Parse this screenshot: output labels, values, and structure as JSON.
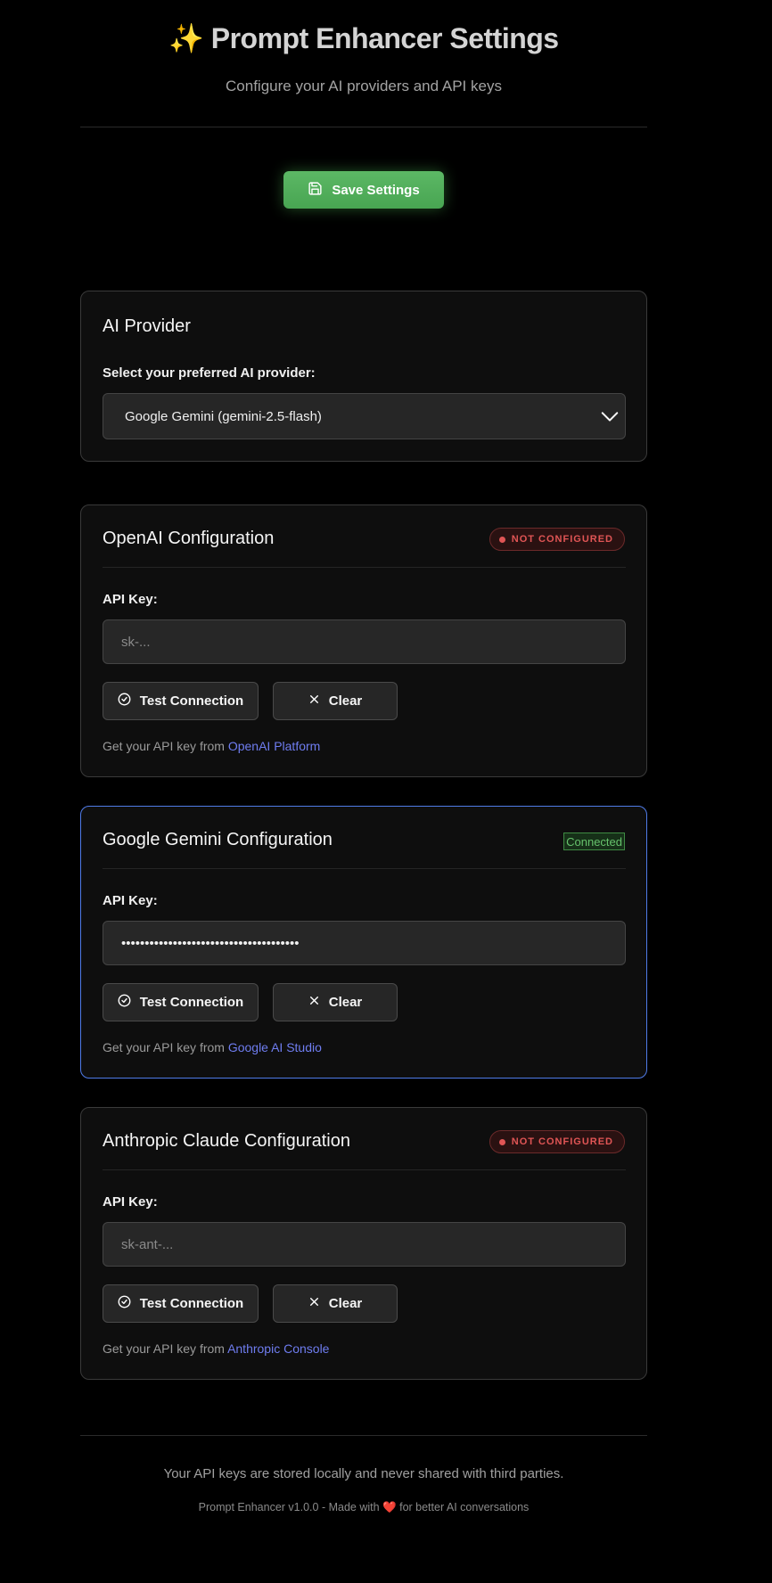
{
  "header": {
    "title_icon": "✨",
    "title": "Prompt Enhancer Settings",
    "subtitle": "Configure your AI providers and API keys"
  },
  "toolbar": {
    "save_label": "Save Settings",
    "save_icon": "save-icon"
  },
  "provider": {
    "heading": "AI Provider",
    "label": "Select your preferred AI provider:",
    "selected": "Google Gemini (gemini-2.5-flash)"
  },
  "openai": {
    "heading": "OpenAI Configuration",
    "status": "NOT CONFIGURED",
    "api_key_label": "API Key:",
    "api_key_value": "",
    "api_key_placeholder": "sk-...",
    "test_label": "Test Connection",
    "clear_label": "Clear",
    "help_prefix": "Get your API key from",
    "help_link": "OpenAI Platform"
  },
  "gemini": {
    "heading": "Google Gemini Configuration",
    "status": "Connected",
    "api_key_label": "API Key:",
    "api_key_value": "••••••••••••••••••••••••••••••••••••••",
    "api_key_placeholder": "",
    "test_label": "Test Connection",
    "clear_label": "Clear",
    "help_prefix": "Get your API key from",
    "help_link": "Google AI Studio"
  },
  "anthropic": {
    "heading": "Anthropic Claude Configuration",
    "status": "NOT CONFIGURED",
    "api_key_label": "API Key:",
    "api_key_value": "",
    "api_key_placeholder": "sk-ant-...",
    "test_label": "Test Connection",
    "clear_label": "Clear",
    "help_prefix": "Get your API key from",
    "help_link": "Anthropic Console"
  },
  "footer": {
    "notice": "Your API keys are stored locally and never shared with third parties.",
    "version_prefix": "Prompt Enhancer v1.0.0 - Made with",
    "heart": "❤️",
    "version_suffix": "for better AI conversations"
  },
  "colors": {
    "accent_green": "#4caf50",
    "link": "#6f7df0",
    "error": "#e05555",
    "active_border": "#4f7be8",
    "success": "#66c26c"
  }
}
